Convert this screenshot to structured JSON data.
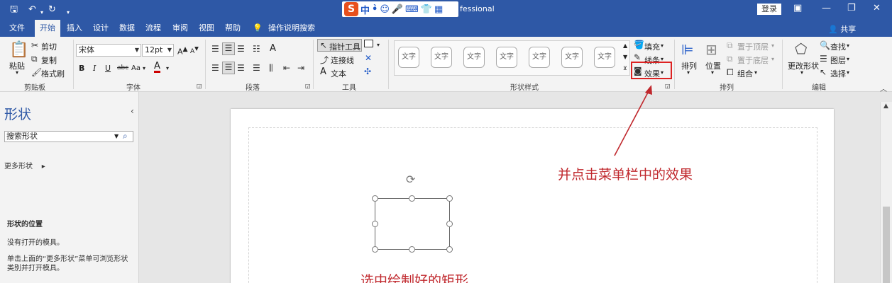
{
  "title_bar": {
    "app_title": "fessional",
    "login_label": "登录",
    "ime_logo": "S",
    "ime_mode": "中"
  },
  "menu": {
    "tabs": [
      "文件",
      "开始",
      "插入",
      "设计",
      "数据",
      "流程",
      "审阅",
      "视图",
      "帮助"
    ],
    "active_tab": "开始",
    "tell_me": "操作说明搜索",
    "share": "共享"
  },
  "ribbon": {
    "clipboard": {
      "paste": "粘贴",
      "cut": "剪切",
      "copy": "复制",
      "format_painter": "格式刷",
      "label": "剪贴板"
    },
    "font": {
      "font_name": "宋体",
      "font_size": "12pt",
      "bold": "B",
      "italic": "I",
      "underline": "U",
      "strike": "abc",
      "case": "Aa",
      "color": "A",
      "grow": "A",
      "shrink": "A",
      "label": "字体"
    },
    "paragraph": {
      "label": "段落",
      "direction": "A"
    },
    "tools": {
      "pointer": "指针工具",
      "connector": "连接线",
      "text": "文本",
      "text_icon": "A",
      "label": "工具"
    },
    "shape_styles": {
      "box_text": "文字",
      "count": 7,
      "label": "形状样式"
    },
    "style_cmds": {
      "fill": "填充",
      "line": "线条",
      "effects": "效果"
    },
    "arrange": {
      "align": "排列",
      "position": "位置",
      "bring_front": "置于顶层",
      "send_back": "置于底层",
      "group": "组合",
      "label": "排列"
    },
    "editing": {
      "change_shape": "更改形状",
      "find": "查找",
      "layers": "图层",
      "select": "选择",
      "label": "编辑"
    }
  },
  "shapes_panel": {
    "title": "形状",
    "search_placeholder": "搜索形状",
    "more_shapes": "更多形状",
    "position_heading": "形状的位置",
    "no_stencil": "没有打开的模具。",
    "hint": "单击上面的“更多形状”菜单可浏览形状类别并打开模具。"
  },
  "annotations": {
    "effects_callout": "并点击菜单栏中的效果",
    "select_rect": "选中绘制好的矩形"
  },
  "colors": {
    "title_bar": "#2e58a6",
    "ribbon": "#f3f3f3",
    "annotation": "#c0282d",
    "highlight_box": "#d22222"
  }
}
